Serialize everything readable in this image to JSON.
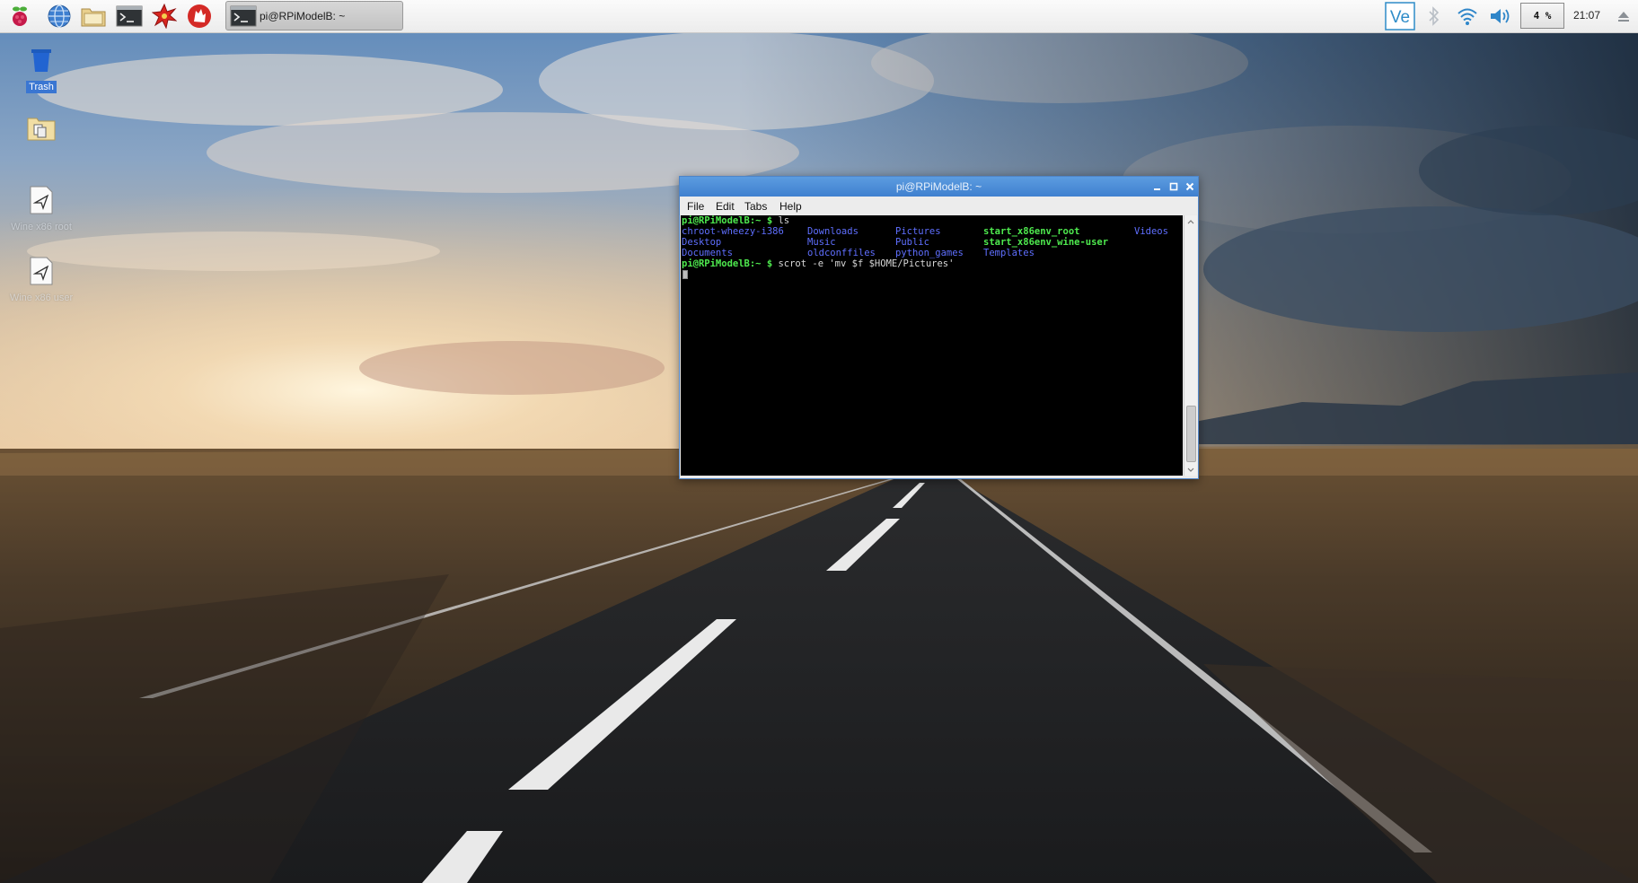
{
  "panel": {
    "launchers": [
      {
        "icon": "raspberry-menu-icon"
      },
      {
        "icon": "web-browser-globe-icon"
      },
      {
        "icon": "file-manager-folder-icon"
      },
      {
        "icon": "terminal-icon"
      },
      {
        "icon": "mathematica-icon"
      },
      {
        "icon": "wolfram-icon"
      }
    ],
    "task_button": {
      "label": "pi@RPiModelB: ~",
      "icon": "terminal-icon"
    },
    "tray": {
      "vnc_icon": "vnc-viewer-icon",
      "bluetooth_icon": "bluetooth-icon",
      "wifi_icon": "wifi-icon",
      "volume_icon": "speaker-volume-icon",
      "cpu_usage": "4 %",
      "clock": "21:07",
      "eject_icon": "eject-icon"
    },
    "accent": "#3a76d2"
  },
  "desktop": {
    "icons": [
      {
        "label": "Trash",
        "icon": "trash-icon",
        "selected": true
      },
      {
        "label": "",
        "icon": "folder-icon"
      },
      {
        "label": "Wine x86 root",
        "icon": "wine-launcher-icon"
      },
      {
        "label": "Wine x86 user",
        "icon": "wine-launcher-icon"
      }
    ]
  },
  "terminal": {
    "title": "pi@RPiModelB: ~",
    "menu": [
      "File",
      "Edit",
      "Tabs",
      "Help"
    ],
    "prompt": "pi@RPiModelB:~ $ ",
    "command1": "ls",
    "command2": "scrot -e 'mv $f $HOME/Pictures'",
    "listing": [
      [
        "chroot-wheezy-i386",
        "Downloads",
        "Pictures",
        "start_x86env_root",
        "Videos"
      ],
      [
        "Desktop",
        "Music",
        "Public",
        "start_x86env_wine-user",
        ""
      ],
      [
        "Documents",
        "oldconffiles",
        "python_games",
        "Templates",
        ""
      ]
    ],
    "colors": {
      "prompt": "#4ee94e",
      "directory": "#5f6fff",
      "executable": "#4ee94e",
      "background": "#000000",
      "title_bar": "#4a8ad6"
    }
  }
}
